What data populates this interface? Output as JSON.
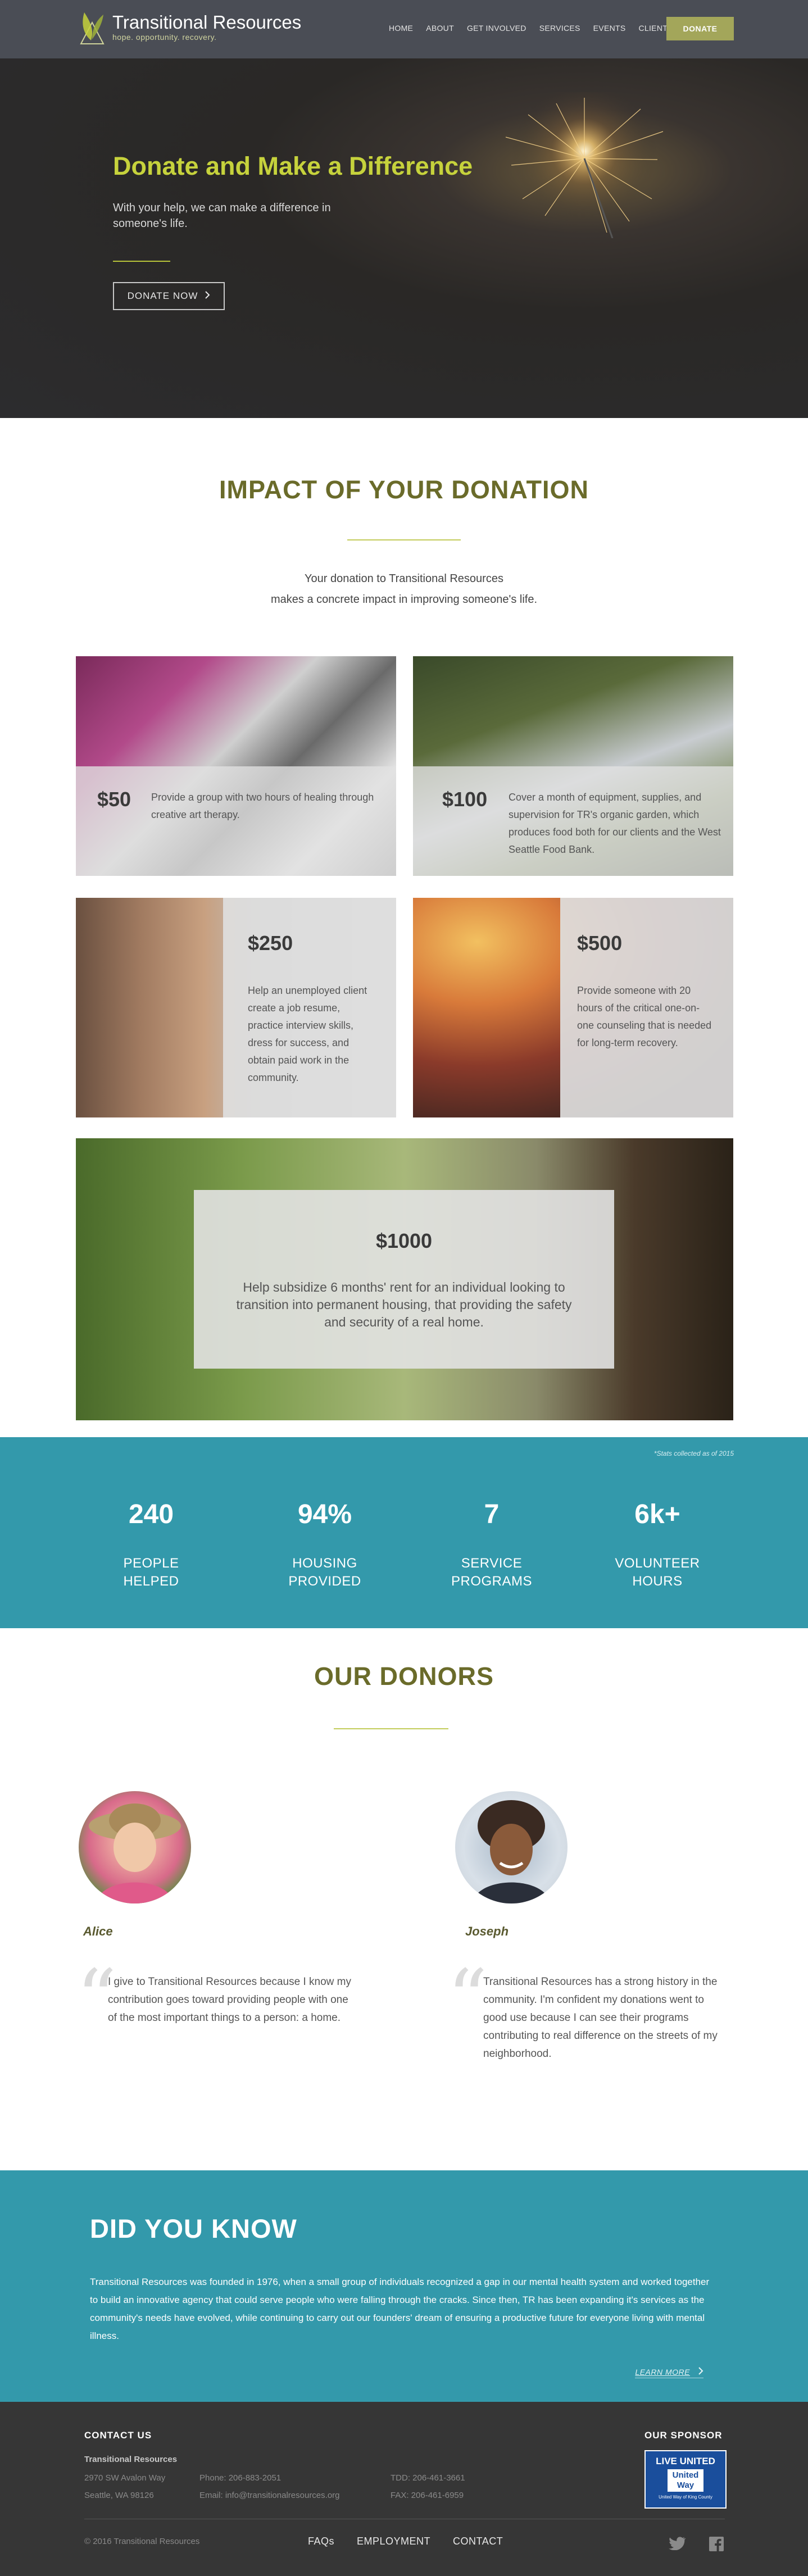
{
  "header": {
    "logo_name": "Transitional Resources",
    "logo_tagline": "hope. opportunity. recovery.",
    "nav": [
      "HOME",
      "ABOUT",
      "GET INVOLVED",
      "SERVICES",
      "EVENTS",
      "CLIENTS"
    ],
    "donate_label": "DONATE"
  },
  "hero": {
    "title": "Donate and Make a Difference",
    "subtitle": "With your help, we can make a difference in someone's life.",
    "button": "DONATE NOW"
  },
  "impact": {
    "title": "IMPACT OF YOUR DONATION",
    "intro_line1": "Your donation to Transitional Resources",
    "intro_line2": "makes a concrete impact in improving someone's life.",
    "tiles": [
      {
        "amount": "$50",
        "text": "Provide a group with two hours of healing through creative art therapy."
      },
      {
        "amount": "$100",
        "text": "Cover a month of equipment, supplies, and supervision for TR's organic garden, which produces food both for our clients and the West Seattle Food Bank."
      },
      {
        "amount": "$250",
        "text": "Help an unemployed client create a job resume, practice interview skills, dress for success, and obtain paid work in the community."
      },
      {
        "amount": "$500",
        "text": "Provide someone with 20 hours of the critical one-on-one counseling that is needed for long-term recovery."
      },
      {
        "amount": "$1000",
        "text": "Help subsidize 6 months' rent for an individual looking to transition into permanent housing, that providing the safety and security of a real home."
      }
    ]
  },
  "stats": {
    "note": "*Stats collected as of 2015",
    "items": [
      {
        "number": "240",
        "label1": "PEOPLE",
        "label2": "HELPED"
      },
      {
        "number": "94%",
        "label1": "HOUSING",
        "label2": "PROVIDED"
      },
      {
        "number": "7",
        "label1": "SERVICE",
        "label2": "PROGRAMS"
      },
      {
        "number": "6k+",
        "label1": "VOLUNTEER",
        "label2": "HOURS"
      }
    ]
  },
  "donors": {
    "title": "OUR DONORS",
    "items": [
      {
        "name": "Alice",
        "quote": "I give to Transitional Resources because I know my contribution goes toward providing people with one of the most important things to a person: a home."
      },
      {
        "name": "Joseph",
        "quote": "Transitional Resources has a strong history in the community.  I'm confident my donations went to good use because I can see their programs contributing to real difference on the streets of my neighborhood."
      }
    ]
  },
  "did_you_know": {
    "title": "DID YOU KNOW",
    "text": "Transitional Resources was founded in 1976, when a small group of individuals recognized a gap in our mental health system and worked together to build an innovative agency that could serve people who were falling through the cracks. Since then, TR has been expanding it's services as the community's needs have evolved, while continuing to carry out our founders' dream of ensuring a productive future for everyone living with mental illness.",
    "learn_more": "LEARN MORE"
  },
  "footer": {
    "contact_heading": "CONTACT US",
    "org_name": "Transitional Resources",
    "address1": "2970 SW Avalon Way",
    "address2": "Seattle, WA 98126",
    "phone": "Phone: 206-883-2051",
    "email": "Email: info@transitionalresources.org",
    "tdd": "TDD: 206-461-3661",
    "fax": "FAX: 206-461-6959",
    "sponsor_heading": "OUR SPONSOR",
    "sponsor_line1": "LIVE UNITED",
    "sponsor_line2": "United",
    "sponsor_line3": "Way",
    "sponsor_line4": "United Way of King County",
    "copyright": "© 2016 Transitional Resources",
    "links": [
      "FAQs",
      "EMPLOYMENT",
      "CONTACT"
    ],
    "social_icons": [
      "twitter-icon",
      "facebook-icon"
    ]
  },
  "colors": {
    "header_bg": "#4a4d55",
    "accent_green": "#a3a65a",
    "hero_title": "#c6d23c",
    "teal": "#3399ab",
    "footer_bg": "#363636",
    "section_title": "#6a6b2a"
  }
}
